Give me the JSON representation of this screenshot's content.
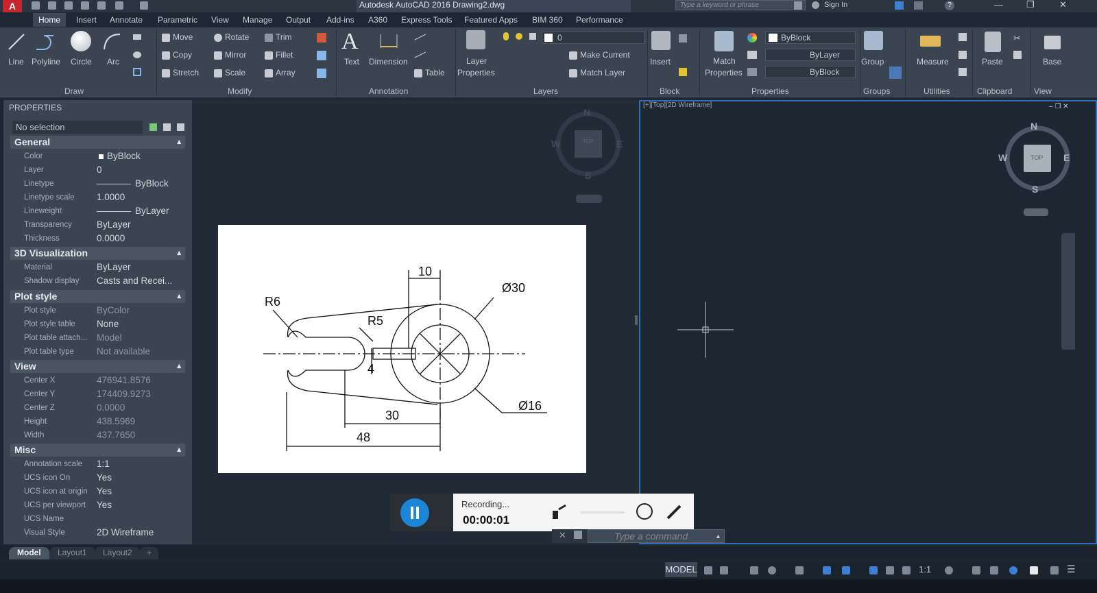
{
  "app": {
    "title": "Autodesk AutoCAD 2016    Drawing2.dwg",
    "logo": "A",
    "search_placeholder": "Type a keyword or phrase",
    "sign_in": "Sign In"
  },
  "menu_tabs": [
    "Home",
    "Insert",
    "Annotate",
    "Parametric",
    "View",
    "Manage",
    "Output",
    "Add-ins",
    "A360",
    "Express Tools",
    "Featured Apps",
    "BIM 360",
    "Performance"
  ],
  "ribbon": {
    "draw": {
      "line": "Line",
      "polyline": "Polyline",
      "circle": "Circle",
      "arc": "Arc",
      "panel": "Draw"
    },
    "modify": {
      "move": "Move",
      "rotate": "Rotate",
      "trim": "Trim",
      "copy": "Copy",
      "mirror": "Mirror",
      "fillet": "Fillet",
      "stretch": "Stretch",
      "scale": "Scale",
      "array": "Array",
      "panel": "Modify"
    },
    "annotation": {
      "text": "Text",
      "dimension": "Dimension",
      "table": "Table",
      "panel": "Annotation"
    },
    "layers": {
      "layer_properties_1": "Layer",
      "layer_properties_2": "Properties",
      "current_layer": "0",
      "make_current": "Make Current",
      "match_layer": "Match Layer",
      "panel": "Layers"
    },
    "block": {
      "insert": "Insert",
      "panel": "Block"
    },
    "properties": {
      "match_1": "Match",
      "match_2": "Properties",
      "color": "ByBlock",
      "linetype": "ByLayer",
      "lineweight": "ByBlock",
      "panel": "Properties"
    },
    "groups": {
      "group": "Group",
      "panel": "Groups"
    },
    "utilities": {
      "measure": "Measure",
      "panel": "Utilities"
    },
    "clipboard": {
      "paste": "Paste",
      "panel": "Clipboard"
    },
    "view": {
      "base": "Base",
      "panel": "View"
    }
  },
  "properties_panel": {
    "header": "PROPERTIES",
    "selection": "No selection",
    "sections": [
      {
        "title": "General",
        "rows": [
          {
            "label": "Color",
            "value": "ByBlock"
          },
          {
            "label": "Layer",
            "value": "0"
          },
          {
            "label": "Linetype",
            "value": "ByBlock"
          },
          {
            "label": "Linetype scale",
            "value": "1.0000"
          },
          {
            "label": "Lineweight",
            "value": "ByLayer"
          },
          {
            "label": "Transparency",
            "value": "ByLayer"
          },
          {
            "label": "Thickness",
            "value": "0.0000"
          }
        ]
      },
      {
        "title": "3D Visualization",
        "rows": [
          {
            "label": "Material",
            "value": "ByLayer"
          },
          {
            "label": "Shadow display",
            "value": "Casts and Recei..."
          }
        ]
      },
      {
        "title": "Plot style",
        "rows": [
          {
            "label": "Plot style",
            "value": "ByColor"
          },
          {
            "label": "Plot style table",
            "value": "None"
          },
          {
            "label": "Plot table attach...",
            "value": "Model"
          },
          {
            "label": "Plot table type",
            "value": "Not available"
          }
        ]
      },
      {
        "title": "View",
        "rows": [
          {
            "label": "Center X",
            "value": "476941.8576"
          },
          {
            "label": "Center Y",
            "value": "174409.9273"
          },
          {
            "label": "Center Z",
            "value": "0.0000"
          },
          {
            "label": "Height",
            "value": "438.5969"
          },
          {
            "label": "Width",
            "value": "437.7650"
          }
        ]
      },
      {
        "title": "Misc",
        "rows": [
          {
            "label": "Annotation scale",
            "value": "1:1"
          },
          {
            "label": "UCS icon On",
            "value": "Yes"
          },
          {
            "label": "UCS icon at origin",
            "value": "Yes"
          },
          {
            "label": "UCS per viewport",
            "value": "Yes"
          },
          {
            "label": "UCS Name",
            "value": ""
          },
          {
            "label": "Visual Style",
            "value": "2D Wireframe"
          }
        ]
      }
    ]
  },
  "viewcube": {
    "n": "N",
    "s": "S",
    "e": "E",
    "w": "W",
    "top": "TOP"
  },
  "viewport_label": "[+][Top][2D Wireframe]",
  "drawing_dims": {
    "d10": "10",
    "d30dia": "Ø30",
    "r6": "R6",
    "r5": "R5",
    "d4": "4",
    "d16dia": "Ø16",
    "d30": "30",
    "d48": "48"
  },
  "recorder": {
    "status": "Recording...",
    "time": "00:00:01"
  },
  "command_placeholder": "Type a command",
  "layout_tabs": [
    "Model",
    "Layout1",
    "Layout2",
    "+"
  ],
  "status": {
    "model": "MODEL",
    "scale": "1:1"
  }
}
